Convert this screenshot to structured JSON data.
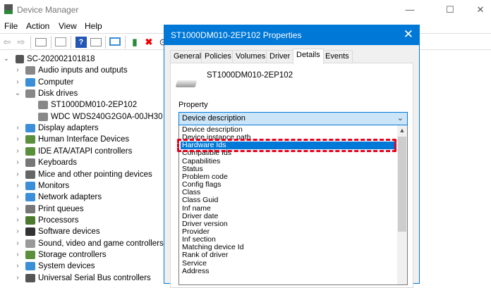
{
  "window": {
    "title": "Device Manager",
    "minimize": "—",
    "maximize": "☐",
    "close": "✕"
  },
  "menu": [
    "File",
    "Action",
    "View",
    "Help"
  ],
  "tree": {
    "root": "SC-202002101818",
    "items": [
      {
        "label": "Audio inputs and outputs",
        "level": 1,
        "state": "collapsed",
        "color": "#888"
      },
      {
        "label": "Computer",
        "level": 1,
        "state": "collapsed",
        "color": "#3b8fd9"
      },
      {
        "label": "Disk drives",
        "level": 1,
        "state": "expanded",
        "color": "#888"
      },
      {
        "label": "ST1000DM010-2EP102",
        "level": 2,
        "state": "leaf",
        "color": "#888"
      },
      {
        "label": "WDC WDS240G2G0A-00JH30",
        "level": 2,
        "state": "leaf",
        "color": "#888"
      },
      {
        "label": "Display adapters",
        "level": 1,
        "state": "collapsed",
        "color": "#3b8fd9"
      },
      {
        "label": "Human Interface Devices",
        "level": 1,
        "state": "collapsed",
        "color": "#5a8f3c"
      },
      {
        "label": "IDE ATA/ATAPI controllers",
        "level": 1,
        "state": "collapsed",
        "color": "#5a8f3c"
      },
      {
        "label": "Keyboards",
        "level": 1,
        "state": "collapsed",
        "color": "#777"
      },
      {
        "label": "Mice and other pointing devices",
        "level": 1,
        "state": "collapsed",
        "color": "#666"
      },
      {
        "label": "Monitors",
        "level": 1,
        "state": "collapsed",
        "color": "#3b8fd9"
      },
      {
        "label": "Network adapters",
        "level": 1,
        "state": "collapsed",
        "color": "#3b8fd9"
      },
      {
        "label": "Print queues",
        "level": 1,
        "state": "collapsed",
        "color": "#777"
      },
      {
        "label": "Processors",
        "level": 1,
        "state": "collapsed",
        "color": "#4c7a2c"
      },
      {
        "label": "Software devices",
        "level": 1,
        "state": "collapsed",
        "color": "#333"
      },
      {
        "label": "Sound, video and game controllers",
        "level": 1,
        "state": "collapsed",
        "color": "#999"
      },
      {
        "label": "Storage controllers",
        "level": 1,
        "state": "collapsed",
        "color": "#5a8f3c"
      },
      {
        "label": "System devices",
        "level": 1,
        "state": "collapsed",
        "color": "#3b8fd9"
      },
      {
        "label": "Universal Serial Bus controllers",
        "level": 1,
        "state": "collapsed",
        "color": "#555"
      }
    ]
  },
  "dialog": {
    "title": "ST1000DM010-2EP102 Properties",
    "close": "✕",
    "tabs": [
      "General",
      "Policies",
      "Volumes",
      "Driver",
      "Details",
      "Events"
    ],
    "active_tab": "Details",
    "device_name": "ST1000DM010-2EP102",
    "property_label": "Property",
    "combo_value": "Device description",
    "options": [
      "Device description",
      "Device instance path",
      "Hardware Ids",
      "Compatible Ids",
      "Capabilities",
      "Status",
      "Problem code",
      "Config flags",
      "Class",
      "Class Guid",
      "Inf name",
      "Driver date",
      "Driver version",
      "Provider",
      "Inf section",
      "Matching device Id",
      "Rank of driver",
      "Service",
      "Address"
    ],
    "selected_option": "Hardware Ids",
    "highlight_color": "#e8001c"
  }
}
